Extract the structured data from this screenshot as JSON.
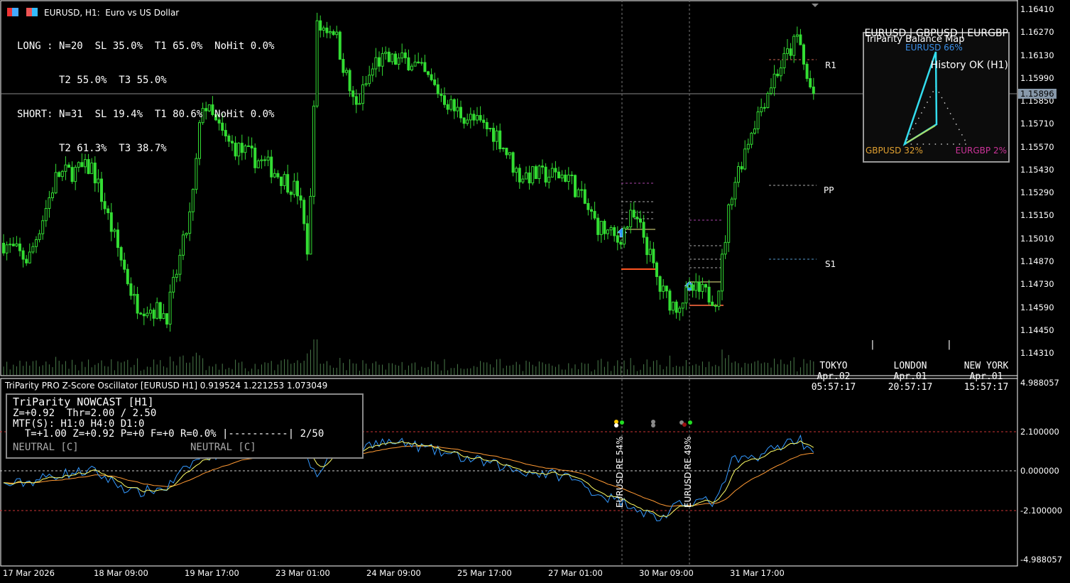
{
  "window": {
    "symbol_title": "EURUSD, H1:  Euro vs US Dollar"
  },
  "stats": {
    "long_line1": "LONG : N=20  SL 35.0%  T1 65.0%  NoHit 0.0%",
    "long_line2": "       T2 55.0%  T3 55.0%",
    "short_line1": "SHORT: N=31  SL 19.4%  T1 80.6%  NoHit 0.0%",
    "short_line2": "       T2 61.3%  T3 38.7%"
  },
  "pairs": {
    "title": "EURUSD | GBPUSD | EURGBP",
    "status": "History OK (H1)"
  },
  "balance_map": {
    "title": "TriParity Balance Map",
    "eurusd": "EURUSD 66%",
    "gbpusd": "GBPUSD 32%",
    "eurgbp": "EURGBP 2%",
    "weights": {
      "EURUSD": 66,
      "GBPUSD": 32,
      "EURGBP": 2
    }
  },
  "pivots": {
    "r1": "R1",
    "pp": "PP",
    "s1": "S1"
  },
  "sessions": [
    {
      "name": "TOKYO",
      "date": "Apr.02",
      "time": "05:57:17"
    },
    {
      "name": "LONDON",
      "date": "Apr.01",
      "time": "20:57:17"
    },
    {
      "name": "NEW YORK",
      "date": "Apr.01",
      "time": "15:57:17"
    }
  ],
  "price_axis": [
    "1.16410",
    "1.16270",
    "1.16130",
    "1.15990",
    "1.15850",
    "1.15710",
    "1.15570",
    "1.15430",
    "1.15290",
    "1.15150",
    "1.15010",
    "1.14870",
    "1.14730",
    "1.14590",
    "1.14450",
    "1.14310"
  ],
  "current_price": "1.15896",
  "oscillator": {
    "title": "TriParity PRO Z-Score Oscillator [EURUSD H1] 0.919524 1.221253 1.073049",
    "axis": [
      "4.988057",
      "2.100000",
      "0.000000",
      "-2.100000",
      "-4.988057"
    ],
    "markers": [
      "EURUSD RE 54%",
      "EURUSD RE 49%"
    ]
  },
  "nowcast": {
    "line1": "TriParity NOWCAST [H1]",
    "line2": "Z=+0.92  Thr=2.00 / 2.50",
    "line3": "MTF(S): H1:0 H4:0 D1:0",
    "line4": "  T=+1.00 Z=+0.92 P=+0 F=+0 R=0.0% |----------| 2/50",
    "state_left": "NEUTRAL [C]",
    "state_right": "NEUTRAL [C]"
  },
  "time_axis": [
    "17 Mar 2026",
    "18 Mar 09:00",
    "19 Mar 17:00",
    "23 Mar 01:00",
    "24 Mar 09:00",
    "25 Mar 17:00",
    "27 Mar 01:00",
    "30 Mar 09:00",
    "31 Mar 17:00"
  ],
  "chart_data": {
    "type": "candlestick",
    "approx_close_path": [
      1.15,
      1.1488,
      1.154,
      1.1545,
      1.1462,
      1.1455,
      1.152,
      1.1585,
      1.156,
      1.1545,
      1.153,
      1.149,
      1.163,
      1.163,
      1.158,
      1.161,
      1.161,
      1.158,
      1.1565,
      1.154,
      1.154,
      1.151,
      1.15,
      1.1515,
      1.1505,
      1.147,
      1.146,
      1.147,
      1.1465,
      1.153,
      1.157,
      1.16,
      1.1625,
      1.16,
      1.159
    ],
    "approx_zscore_path": [
      -0.8,
      -0.6,
      -0.2,
      0,
      -1.2,
      -0.9,
      0.4,
      0.8,
      1.0,
      1.2,
      1.6,
      0.6,
      -0.4,
      1.2,
      1.0,
      1.6,
      1.4,
      0.8,
      0.3,
      0,
      -0.3,
      -1.2,
      -1.6,
      -1.8,
      -2.2,
      -2.6,
      -2.0,
      -1.6,
      -1.7,
      0.5,
      0.7,
      1.2,
      1.8,
      1.3,
      1.2
    ]
  },
  "colors": {
    "bull": "#33dd33",
    "bear": "#33dd33",
    "zscore": "#3399ff",
    "signal": "#ffff66",
    "slow": "#ff9933",
    "level": "#cc3333"
  }
}
